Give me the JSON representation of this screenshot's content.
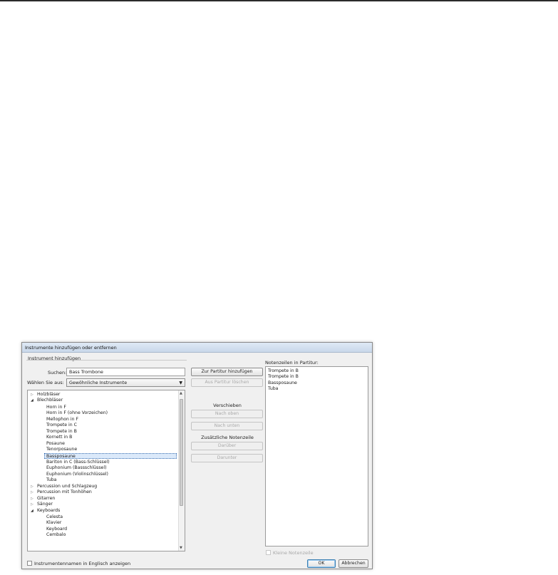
{
  "window": {
    "title": "Instrumente hinzufügen oder entfernen"
  },
  "left_panel": {
    "group_label": "Instrument hinzufügen",
    "search_label": "Suchen:",
    "search_value": "Bass Trombone",
    "select_label": "Wählen Sie aus:",
    "select_value": "Gewöhnliche Instrumente"
  },
  "tree": {
    "groups": {
      "holzblaeser": "Holzbläser",
      "blechblaeser": "Blechbläser",
      "percussion": "Percussion und Schlagzeug",
      "percussion_tonhoehen": "Percussion mit Tonhöhen",
      "gitarren": "Gitarren",
      "saenger": "Sänger",
      "keyboards": "Keyboards"
    },
    "brass_items": [
      "Horn in F",
      "Horn in F (ohne Vorzeichen)",
      "Mellophon in F",
      "Trompete in C",
      "Trompete in B",
      "Kornett in B",
      "Posaune",
      "Tenorposaune",
      "Bassposaune",
      "Bariton in C (Bass-Schlüssel)",
      "Euphonium (Bassschlüssel)",
      "Euphonium (Violinschlüssel)",
      "Tuba"
    ],
    "selected_item": "Bassposaune",
    "keyboard_items": [
      "Celesta",
      "Klavier",
      "Keyboard",
      "Cembalo"
    ]
  },
  "middle": {
    "add_button": "Zur Partitur hinzufügen",
    "remove_button": "Aus Partitur löschen",
    "move_label": "Verschieben",
    "up_button": "Nach oben",
    "down_button": "Nach unten",
    "extra_staff_label": "Zusätzliche Notenzeile",
    "above_button": "Darüber",
    "below_button": "Darunter"
  },
  "right_panel": {
    "label": "Notenzeilen in Partitur:",
    "staves": [
      "Trompete in B",
      "Trompete in B",
      "Bassposaune",
      "Tuba"
    ],
    "small_staff_label": "Kleine Notenzeile"
  },
  "footer": {
    "english_names_label": "Instrumentennamen in Englisch anzeigen",
    "ok_button": "OK",
    "cancel_button": "Abbrechen"
  },
  "icons": {
    "collapsed": "triangle-right-icon",
    "expanded": "triangle-down-icon",
    "dropdown": "chevron-down-icon"
  }
}
